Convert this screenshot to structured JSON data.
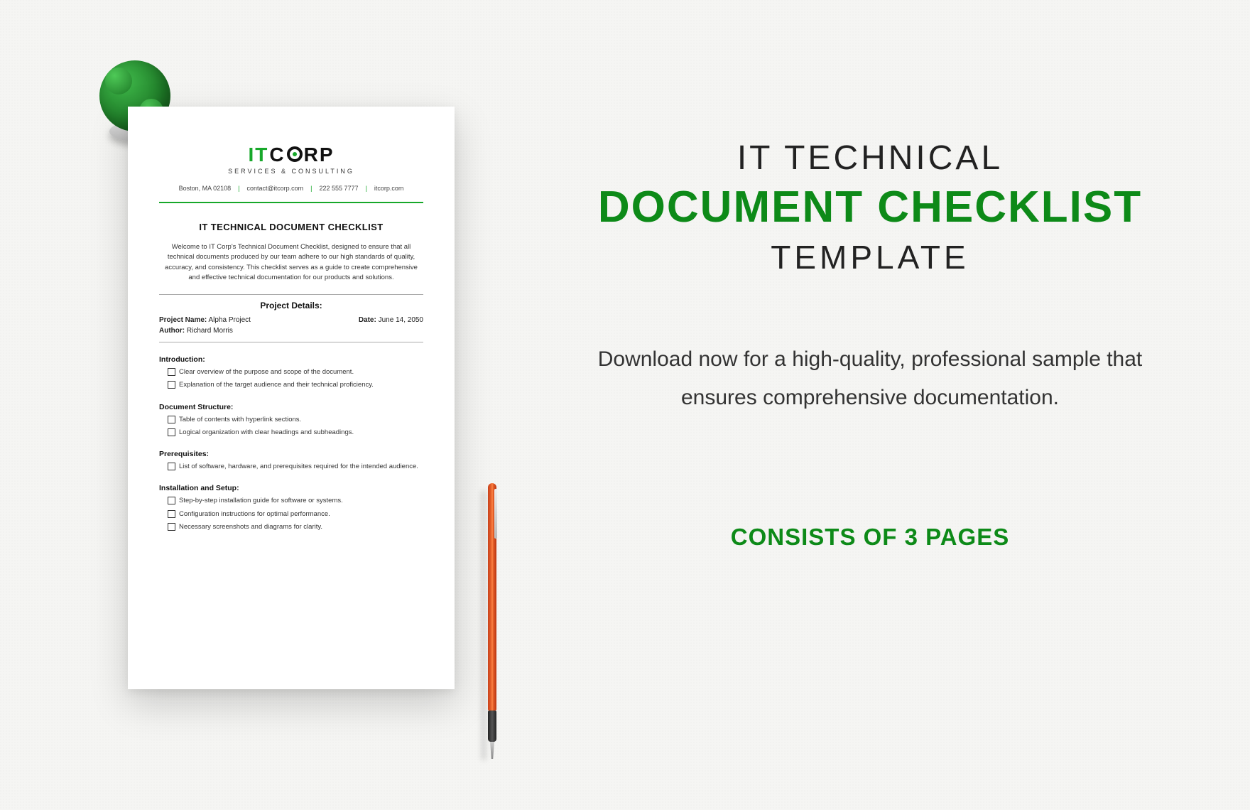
{
  "right": {
    "title_line1": "IT TECHNICAL",
    "title_line2": "DOCUMENT CHECKLIST",
    "title_line3": "TEMPLATE",
    "description": "Download now for a high-quality, professional sample that ensures comprehensive documentation.",
    "consists": "CONSISTS OF 3 PAGES"
  },
  "doc": {
    "logo_it": "IT",
    "logo_c": "C",
    "logo_rp": "RP",
    "logo_sub": "SERVICES & CONSULTING",
    "contact": {
      "address": "Boston, MA 02108",
      "email": "contact@itcorp.com",
      "phone": "222 555 7777",
      "site": "itcorp.com"
    },
    "title": "IT TECHNICAL DOCUMENT CHECKLIST",
    "intro": "Welcome to IT Corp's Technical Document Checklist, designed to ensure that all technical documents produced by our team adhere to our high standards of quality, accuracy, and consistency. This checklist serves as a guide to create comprehensive and effective technical documentation for our products and solutions.",
    "project_heading": "Project Details:",
    "details": {
      "project_label": "Project Name:",
      "project_value": "Alpha Project",
      "date_label": "Date:",
      "date_value": "June 14, 2050",
      "author_label": "Author:",
      "author_value": "Richard Morris"
    },
    "sections": [
      {
        "title": "Introduction:",
        "items": [
          "Clear overview of the purpose and scope of the document.",
          "Explanation of the target audience and their technical proficiency."
        ]
      },
      {
        "title": "Document Structure:",
        "items": [
          "Table of contents with hyperlink sections.",
          "Logical organization with clear headings and subheadings."
        ]
      },
      {
        "title": "Prerequisites:",
        "items": [
          "List of software, hardware, and prerequisites required for the intended audience."
        ]
      },
      {
        "title": "Installation and Setup:",
        "items": [
          "Step-by-step installation guide for software or systems.",
          "Configuration instructions for optimal performance.",
          "Necessary screenshots and diagrams for clarity."
        ]
      }
    ]
  }
}
